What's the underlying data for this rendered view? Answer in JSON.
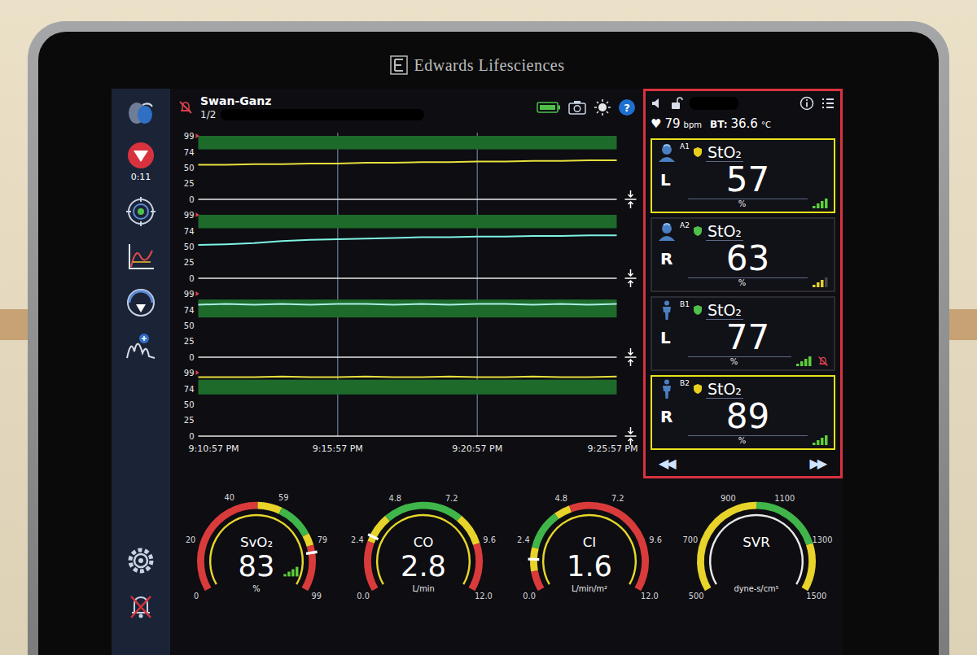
{
  "device": {
    "brand": "Edwards Lifesciences"
  },
  "header": {
    "title": "Swan-Ganz",
    "page": "1/2",
    "alarm_silenced": true,
    "help": "?"
  },
  "sidebar": {
    "timer": "0:11"
  },
  "chart": {
    "y_ticks": [
      "99",
      "74",
      "50",
      "25",
      "0"
    ],
    "x_ticks": [
      "9:10:57 PM",
      "9:15:57 PM",
      "9:20:57 PM",
      "9:25:57 PM"
    ],
    "series": [
      {
        "color": "#e6df3c",
        "target": {
          "low": 78,
          "high": 99
        },
        "values": [
          54,
          54,
          55,
          55,
          56,
          56,
          57,
          57,
          58,
          58,
          59,
          59,
          60,
          60,
          61,
          61
        ]
      },
      {
        "color": "#7ff3e4",
        "target": {
          "low": 78,
          "high": 99
        },
        "values": [
          52,
          53,
          55,
          58,
          60,
          61,
          62,
          63,
          64,
          64,
          65,
          65,
          66,
          66,
          67,
          67
        ]
      },
      {
        "color": "#a9efe6",
        "target": {
          "low": 62,
          "high": 90
        },
        "values": [
          82,
          83,
          82,
          83,
          82,
          83,
          83,
          82,
          83,
          82,
          83,
          83,
          82,
          83,
          82,
          83
        ]
      },
      {
        "color": "#e6df3c",
        "target": {
          "low": 65,
          "high": 88
        },
        "values": [
          92,
          92,
          92,
          93,
          92,
          92,
          93,
          92,
          92,
          93,
          92,
          92,
          93,
          92,
          92,
          93
        ]
      }
    ]
  },
  "status": {
    "heart_icon": "♥",
    "heart_rate": "79",
    "heart_unit": "bpm",
    "temp_label": "BT:",
    "temp": "36.6",
    "temp_unit": "°C"
  },
  "tiles": [
    {
      "channel": "A1",
      "kind": "cerebral",
      "param": "StO₂",
      "side": "L",
      "value": "57",
      "unit": "%",
      "alarm": true,
      "alarm_off": false,
      "shield_color": "#e8cf1e",
      "signal": 1.0,
      "signal_color": "#5ccf3a"
    },
    {
      "channel": "A2",
      "kind": "cerebral",
      "param": "StO₂",
      "side": "R",
      "value": "63",
      "unit": "%",
      "alarm": false,
      "alarm_off": false,
      "shield_color": "#4fc04a",
      "signal": 0.75,
      "signal_color": "#e3cf2a"
    },
    {
      "channel": "B1",
      "kind": "somatic",
      "param": "StO₂",
      "side": "L",
      "value": "77",
      "unit": "%",
      "alarm": false,
      "alarm_off": true,
      "shield_color": "#4fc04a",
      "signal": 1.0,
      "signal_color": "#5ccf3a"
    },
    {
      "channel": "B2",
      "kind": "somatic",
      "param": "StO₂",
      "side": "R",
      "value": "89",
      "unit": "%",
      "alarm": true,
      "alarm_off": false,
      "shield_color": "#e8cf1e",
      "signal": 1.0,
      "signal_color": "#5ccf3a"
    }
  ],
  "nav": {
    "prev": "◀◀",
    "next": "▶▶"
  },
  "gauges": [
    {
      "label": "SvO₂",
      "value": "83",
      "unit": "%",
      "ticks": [
        "0",
        "20",
        "40",
        "59",
        "79",
        "99"
      ],
      "alert": true,
      "signal": 1.0,
      "signal_color": "#5ccf3a",
      "zones": [
        {
          "from": 0,
          "to": 50,
          "color": "#d93b3b"
        },
        {
          "from": 50,
          "to": 60,
          "color": "#e7d32a"
        },
        {
          "from": 60,
          "to": 75,
          "color": "#3fb54a"
        },
        {
          "from": 75,
          "to": 80,
          "color": "#e7d32a"
        },
        {
          "from": 80,
          "to": 99,
          "color": "#d93b3b"
        }
      ]
    },
    {
      "label": "CO",
      "value": "2.8",
      "unit": "L/min",
      "ticks": [
        "0.0",
        "2.4",
        "4.8",
        "7.2",
        "9.6",
        "12.0"
      ],
      "alert": true,
      "zones": [
        {
          "from": 0,
          "to": 2.5,
          "color": "#d93b3b"
        },
        {
          "from": 2.5,
          "to": 4,
          "color": "#e7d32a"
        },
        {
          "from": 4,
          "to": 8,
          "color": "#3fb54a"
        },
        {
          "from": 8,
          "to": 9.6,
          "color": "#e7d32a"
        },
        {
          "from": 9.6,
          "to": 12,
          "color": "#d93b3b"
        }
      ]
    },
    {
      "label": "CI",
      "value": "1.6",
      "unit": "L/min/m²",
      "ticks": [
        "0.0",
        "2.4",
        "4.8",
        "7.2",
        "9.6",
        "12.0"
      ],
      "alert": true,
      "zones": [
        {
          "from": 0,
          "to": 1,
          "color": "#d93b3b"
        },
        {
          "from": 1,
          "to": 2.2,
          "color": "#e7d32a"
        },
        {
          "from": 2.2,
          "to": 4.2,
          "color": "#3fb54a"
        },
        {
          "from": 4.2,
          "to": 5,
          "color": "#e7d32a"
        },
        {
          "from": 5,
          "to": 12,
          "color": "#d93b3b"
        }
      ]
    },
    {
      "label": "SVR",
      "value": "",
      "unit": "dyne-s/cm⁵",
      "ticks": [
        "500",
        "700",
        "900",
        "1100",
        "1300",
        "1500"
      ],
      "alert": false,
      "zones": [
        {
          "from": 500,
          "to": 1000,
          "color": "#e7d32a"
        },
        {
          "from": 1000,
          "to": 1300,
          "color": "#3fb54a"
        },
        {
          "from": 1300,
          "to": 1500,
          "color": "#e7d32a"
        }
      ]
    }
  ]
}
